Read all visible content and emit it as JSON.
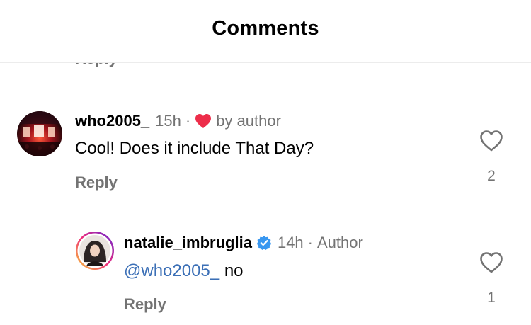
{
  "header": {
    "title": "Comments"
  },
  "partial_reply_label": "Reply",
  "comments": [
    {
      "username": "who2005_",
      "time": "15h",
      "separator": "·",
      "liked_by_author_label": "by author",
      "text": "Cool! Does it include That Day?",
      "reply_label": "Reply",
      "like_count": "2",
      "avatar_icon": "concert-photo-avatar"
    },
    {
      "username": "natalie_imbruglia",
      "verified": true,
      "time": "14h",
      "separator": "·",
      "author_label": "Author",
      "mention": "@who2005_",
      "text": "no",
      "reply_label": "Reply",
      "like_count": "1",
      "avatar_icon": "profile-photo-avatar"
    }
  ],
  "colors": {
    "secondary_text": "#737373",
    "mention": "#3b6fb6",
    "heart_red": "#ed2d4a",
    "verified_blue": "#3897f0"
  }
}
